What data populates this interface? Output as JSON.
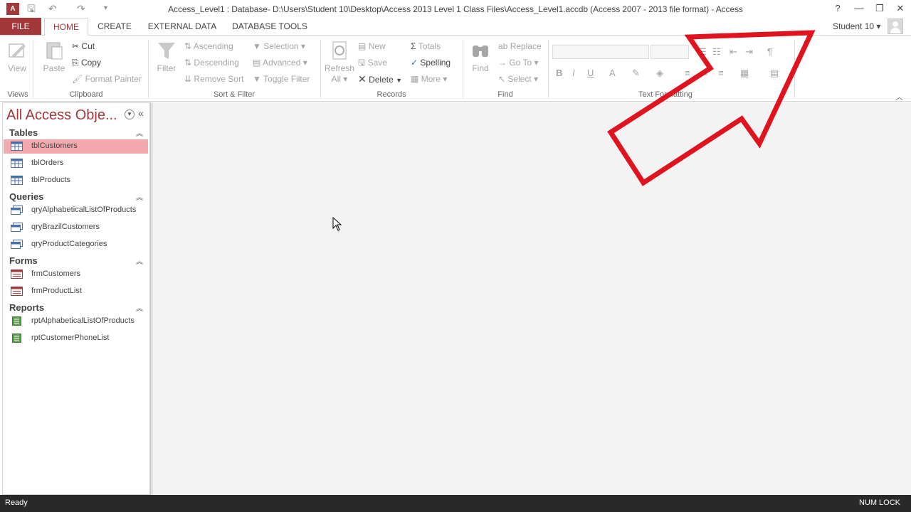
{
  "window": {
    "title": "Access_Level1 : Database- D:\\Users\\Student 10\\Desktop\\Access 2013 Level 1 Class Files\\Access_Level1.accdb (Access 2007 - 2013 file format) - Access",
    "app_icon": "A",
    "help": "?",
    "minimize": "—",
    "restore": "❐",
    "close": "✕",
    "user": "Student 10 ▾"
  },
  "tabs": {
    "file": "FILE",
    "home": "HOME",
    "create": "CREATE",
    "external": "EXTERNAL DATA",
    "dbtools": "DATABASE TOOLS"
  },
  "ribbon": {
    "views": {
      "view": "View",
      "label": "Views"
    },
    "clipboard": {
      "paste": "Paste",
      "cut": "Cut",
      "copy": "Copy",
      "format_painter": "Format Painter",
      "label": "Clipboard"
    },
    "sort": {
      "filter": "Filter",
      "ascending": "Ascending",
      "descending": "Descending",
      "remove_sort": "Remove Sort",
      "selection": "Selection ▾",
      "advanced": "Advanced ▾",
      "toggle_filter": "Toggle Filter",
      "label": "Sort & Filter"
    },
    "records": {
      "refresh": "Refresh",
      "refresh2": "All ▾",
      "new": "New",
      "save": "Save",
      "delete": "Delete",
      "totals": "Totals",
      "spelling": "Spelling",
      "more": "More ▾",
      "label": "Records"
    },
    "find": {
      "find": "Find",
      "replace": "Replace",
      "goto": "Go To ▾",
      "select": "Select ▾",
      "label": "Find"
    },
    "text": {
      "bold": "B",
      "italic": "I",
      "underline": "U",
      "label": "Text Formatting"
    }
  },
  "nav": {
    "title": "All Access Obje...",
    "sections": [
      {
        "label": "Tables",
        "items": [
          "tblCustomers",
          "tblOrders",
          "tblProducts"
        ]
      },
      {
        "label": "Queries",
        "items": [
          "qryAlphabeticalListOfProducts",
          "qryBrazilCustomers",
          "qryProductCategories"
        ]
      },
      {
        "label": "Forms",
        "items": [
          "frmCustomers",
          "frmProductList"
        ]
      },
      {
        "label": "Reports",
        "items": [
          "rptAlphabeticalListOfProducts",
          "rptCustomerPhoneList"
        ]
      }
    ]
  },
  "status": {
    "left": "Ready",
    "right": "NUM LOCK"
  },
  "colors": {
    "accent": "#a4373a",
    "selected": "#f4a9ae",
    "annotation": "#e0141e"
  }
}
